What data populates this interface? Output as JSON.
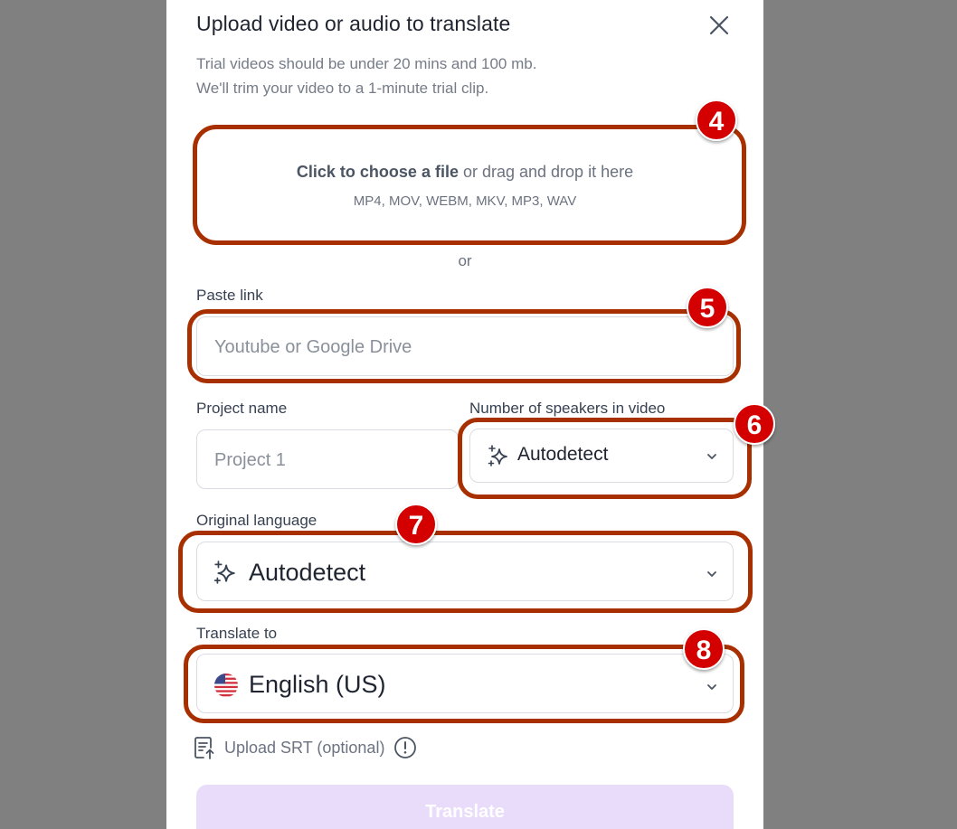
{
  "dialog": {
    "title": "Upload video or audio to translate",
    "subtitle_line1": "Trial videos should be under 20 mins and 100 mb.",
    "subtitle_line2": "We'll trim your video to a 1-minute trial clip."
  },
  "dropzone": {
    "link_text": "Click to choose a file",
    "rest_text": " or drag and drop it here",
    "formats": "MP4, MOV, WEBM, MKV, MP3, WAV"
  },
  "or_text": "or",
  "paste_link": {
    "label": "Paste link",
    "placeholder": "Youtube or Google Drive"
  },
  "project_name": {
    "label": "Project name",
    "placeholder": "Project 1"
  },
  "speakers": {
    "label": "Number of speakers in video",
    "value": "Autodetect",
    "icon": "sparkle-icon"
  },
  "original_language": {
    "label": "Original language",
    "value": "Autodetect",
    "icon": "sparkle-icon"
  },
  "translate_to": {
    "label": "Translate to",
    "value": "English (US)",
    "icon": "us-flag-icon"
  },
  "srt": {
    "label": "Upload SRT (optional)"
  },
  "translate_button": "Translate",
  "annotations": {
    "b4": "4",
    "b5": "5",
    "b6": "6",
    "b7": "7",
    "b8": "8"
  },
  "colors": {
    "annotation_ring": "#a83000",
    "badge": "#d40000",
    "button_disabled": "#e9dcfb",
    "overlay": "#808080"
  }
}
